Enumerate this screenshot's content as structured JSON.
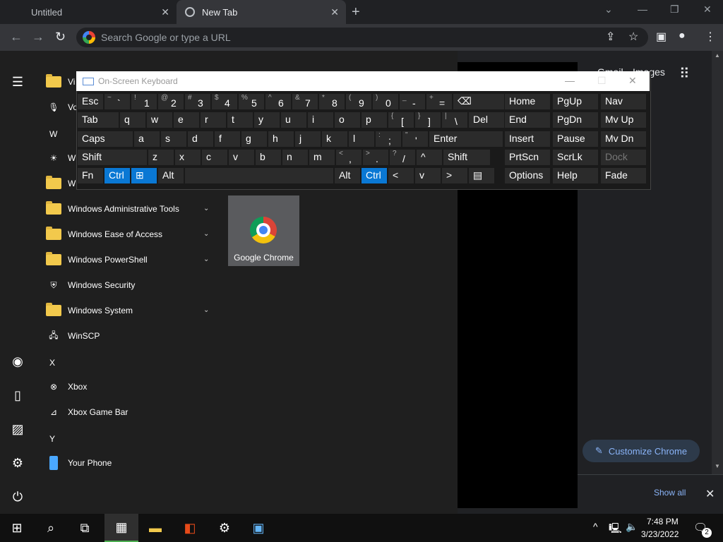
{
  "browser": {
    "tabs": [
      {
        "label": "Untitled"
      },
      {
        "label": "New Tab"
      }
    ],
    "omnibox_placeholder": "Search Google or type a URL",
    "ntp": {
      "gmail": "Gmail",
      "images": "Images",
      "customize": "Customize Chrome",
      "show_all": "Show all"
    }
  },
  "osk": {
    "title": "On-Screen Keyboard",
    "rows": [
      [
        {
          "sub": "",
          "main": "Esc"
        },
        {
          "sub": "~",
          "main": "`"
        },
        {
          "sub": "!",
          "main": "1"
        },
        {
          "sub": "@",
          "main": "2"
        },
        {
          "sub": "#",
          "main": "3"
        },
        {
          "sub": "$",
          "main": "4"
        },
        {
          "sub": "%",
          "main": "5"
        },
        {
          "sub": "^",
          "main": "6"
        },
        {
          "sub": "&",
          "main": "7"
        },
        {
          "sub": "*",
          "main": "8"
        },
        {
          "sub": "(",
          "main": "9"
        },
        {
          "sub": ")",
          "main": "0"
        },
        {
          "sub": "_",
          "main": "-"
        },
        {
          "sub": "+",
          "main": "="
        },
        {
          "sub": "",
          "main": "⌫"
        }
      ],
      [
        {
          "sub": "",
          "main": "Tab"
        },
        {
          "sub": "",
          "main": "q"
        },
        {
          "sub": "",
          "main": "w"
        },
        {
          "sub": "",
          "main": "e"
        },
        {
          "sub": "",
          "main": "r"
        },
        {
          "sub": "",
          "main": "t"
        },
        {
          "sub": "",
          "main": "y"
        },
        {
          "sub": "",
          "main": "u"
        },
        {
          "sub": "",
          "main": "i"
        },
        {
          "sub": "",
          "main": "o"
        },
        {
          "sub": "",
          "main": "p"
        },
        {
          "sub": "{",
          "main": "["
        },
        {
          "sub": "}",
          "main": "]"
        },
        {
          "sub": "|",
          "main": "\\"
        },
        {
          "sub": "",
          "main": "Del"
        }
      ],
      [
        {
          "sub": "",
          "main": "Caps"
        },
        {
          "sub": "",
          "main": "a"
        },
        {
          "sub": "",
          "main": "s"
        },
        {
          "sub": "",
          "main": "d"
        },
        {
          "sub": "",
          "main": "f"
        },
        {
          "sub": "",
          "main": "g"
        },
        {
          "sub": "",
          "main": "h"
        },
        {
          "sub": "",
          "main": "j"
        },
        {
          "sub": "",
          "main": "k"
        },
        {
          "sub": "",
          "main": "l"
        },
        {
          "sub": ":",
          "main": ";"
        },
        {
          "sub": "\"",
          "main": "'"
        },
        {
          "sub": "",
          "main": "Enter"
        }
      ],
      [
        {
          "sub": "",
          "main": "Shift"
        },
        {
          "sub": "",
          "main": "z"
        },
        {
          "sub": "",
          "main": "x"
        },
        {
          "sub": "",
          "main": "c"
        },
        {
          "sub": "",
          "main": "v"
        },
        {
          "sub": "",
          "main": "b"
        },
        {
          "sub": "",
          "main": "n"
        },
        {
          "sub": "",
          "main": "m"
        },
        {
          "sub": "<",
          "main": ","
        },
        {
          "sub": ">",
          "main": "."
        },
        {
          "sub": "?",
          "main": "/"
        },
        {
          "sub": "",
          "main": "^"
        },
        {
          "sub": "",
          "main": "Shift"
        }
      ],
      [
        {
          "sub": "",
          "main": "Fn"
        },
        {
          "sub": "",
          "main": "Ctrl"
        },
        {
          "sub": "",
          "main": "⊞"
        },
        {
          "sub": "",
          "main": "Alt"
        },
        {
          "sub": "",
          "main": ""
        },
        {
          "sub": "",
          "main": "Alt"
        },
        {
          "sub": "",
          "main": "Ctrl"
        },
        {
          "sub": "",
          "main": "<"
        },
        {
          "sub": "",
          "main": "v"
        },
        {
          "sub": "",
          "main": ">"
        },
        {
          "sub": "",
          "main": "▤"
        }
      ]
    ],
    "right_keys": [
      [
        "Home",
        "PgUp",
        "Nav"
      ],
      [
        "End",
        "PgDn",
        "Mv Up"
      ],
      [
        "Insert",
        "Pause",
        "Mv Dn"
      ],
      [
        "PrtScn",
        "ScrLk",
        "Dock"
      ],
      [
        "Options",
        "Help",
        "Fade"
      ]
    ]
  },
  "startmenu": {
    "items": [
      {
        "label": "Vi",
        "icon": "folder"
      },
      {
        "label": "Vo",
        "icon": "mic-icon"
      },
      {
        "label": "W",
        "icon": "letter"
      },
      {
        "label": "W",
        "icon": "weather-icon"
      },
      {
        "label": "W",
        "icon": "folder"
      },
      {
        "label": "Windows Administrative Tools",
        "icon": "folder",
        "chevron": true
      },
      {
        "label": "Windows Ease of Access",
        "icon": "folder",
        "chevron": true
      },
      {
        "label": "Windows PowerShell",
        "icon": "folder",
        "chevron": true
      },
      {
        "label": "Windows Security",
        "icon": "shield-icon"
      },
      {
        "label": "Windows System",
        "icon": "folder",
        "chevron": true
      },
      {
        "label": "WinSCP",
        "icon": "winscp-icon"
      },
      {
        "label": "X",
        "icon": "letter"
      },
      {
        "label": "Xbox",
        "icon": "xbox-icon"
      },
      {
        "label": "Xbox Game Bar",
        "icon": "gamebar-icon"
      },
      {
        "label": "Y",
        "icon": "letter"
      },
      {
        "label": "Your Phone",
        "icon": "phone-icon"
      }
    ],
    "tile": {
      "label": "Google Chrome"
    }
  },
  "taskbar": {
    "time": "7:48 PM",
    "date": "3/23/2022",
    "notification_count": "2"
  }
}
